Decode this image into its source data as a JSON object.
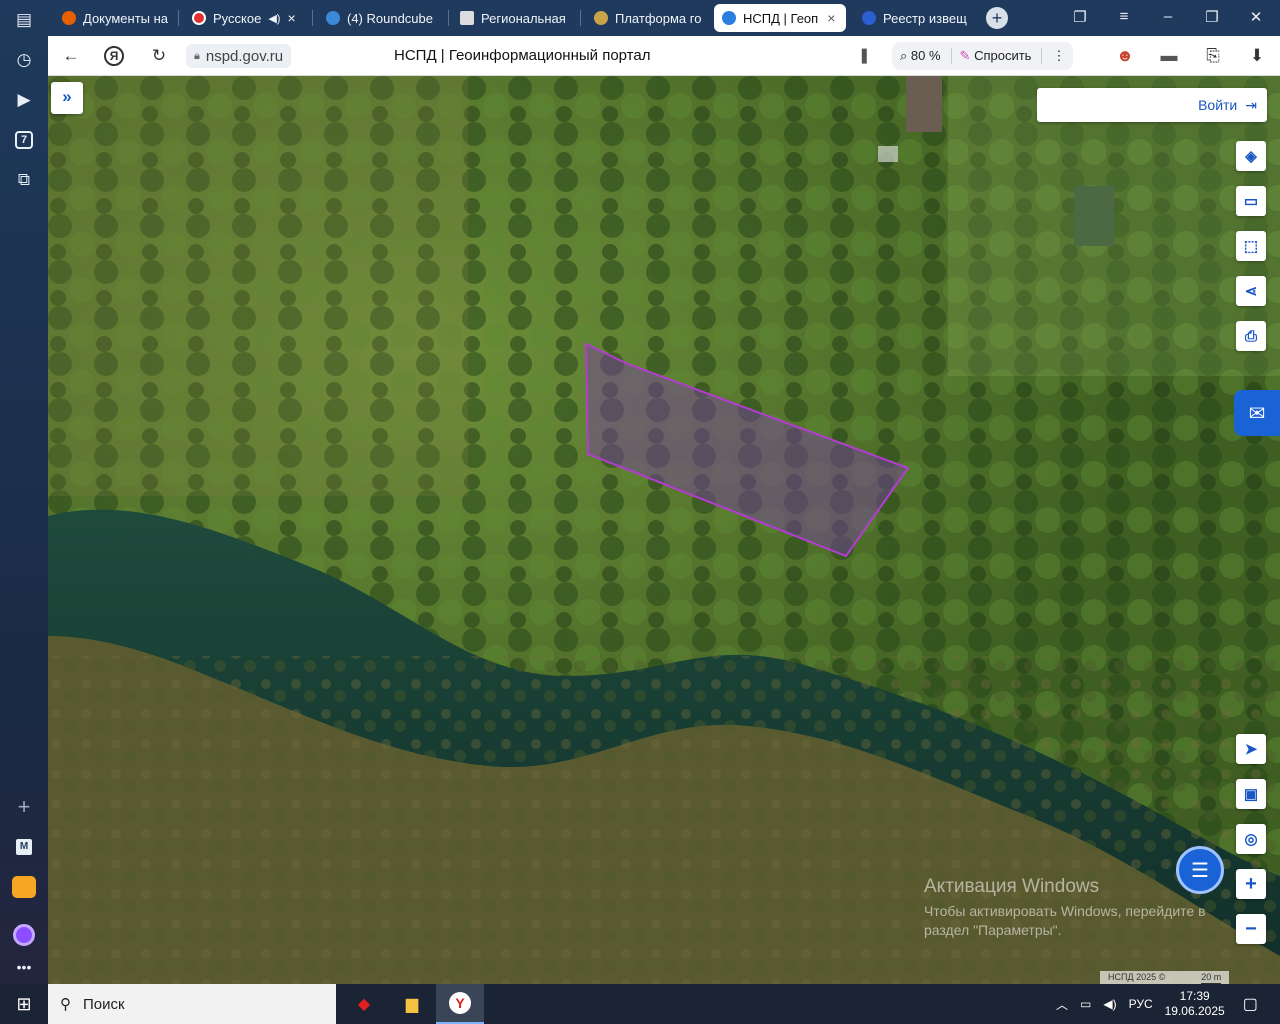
{
  "tabs": [
    {
      "label": "Документы на",
      "icon": "firefox-icon",
      "color": "#e66000"
    },
    {
      "label": "Русское",
      "icon": "audio-site-icon",
      "color": "#e03030"
    },
    {
      "label": "(4) Roundcube",
      "icon": "roundcube-icon",
      "color": "#3a8ad8"
    },
    {
      "label": "Региональная",
      "icon": "page-icon",
      "color": "#dddddd"
    },
    {
      "label": "Платформа го",
      "icon": "emblem-icon",
      "color": "#c9a24a"
    },
    {
      "label": "НСПД | Геоп",
      "icon": "nspd-icon",
      "color": "#2b7de0"
    },
    {
      "label": "Реестр извещ",
      "icon": "registry-icon",
      "color": "#2b5fd0"
    }
  ],
  "toolbar": {
    "url": "nspd.gov.ru",
    "title": "НСПД | Геоинформационный портал",
    "zoom": "80 %",
    "ask": "Спросить"
  },
  "map": {
    "login": "Войти",
    "watermark_title": "Активация Windows",
    "watermark_sub": "Чтобы активировать Windows, перейдите в раздел \"Параметры\".",
    "attribution": "НСПД 2025 ©",
    "scale": "20 m",
    "tools_top": [
      "layers-icon",
      "ruler-icon",
      "area-select-icon",
      "share-icon",
      "print-icon"
    ],
    "tools_bottom": [
      "locate-icon",
      "minimap-icon",
      "geolocation-icon",
      "zoom-in-icon",
      "zoom-out-icon"
    ],
    "parcel_color": "#b43cd2"
  },
  "sidebar": {
    "badge": "7",
    "mail_letter": "M"
  },
  "taskbar": {
    "search": "Поиск",
    "lang": "РУС",
    "time": "17:39",
    "date": "19.06.2025"
  }
}
